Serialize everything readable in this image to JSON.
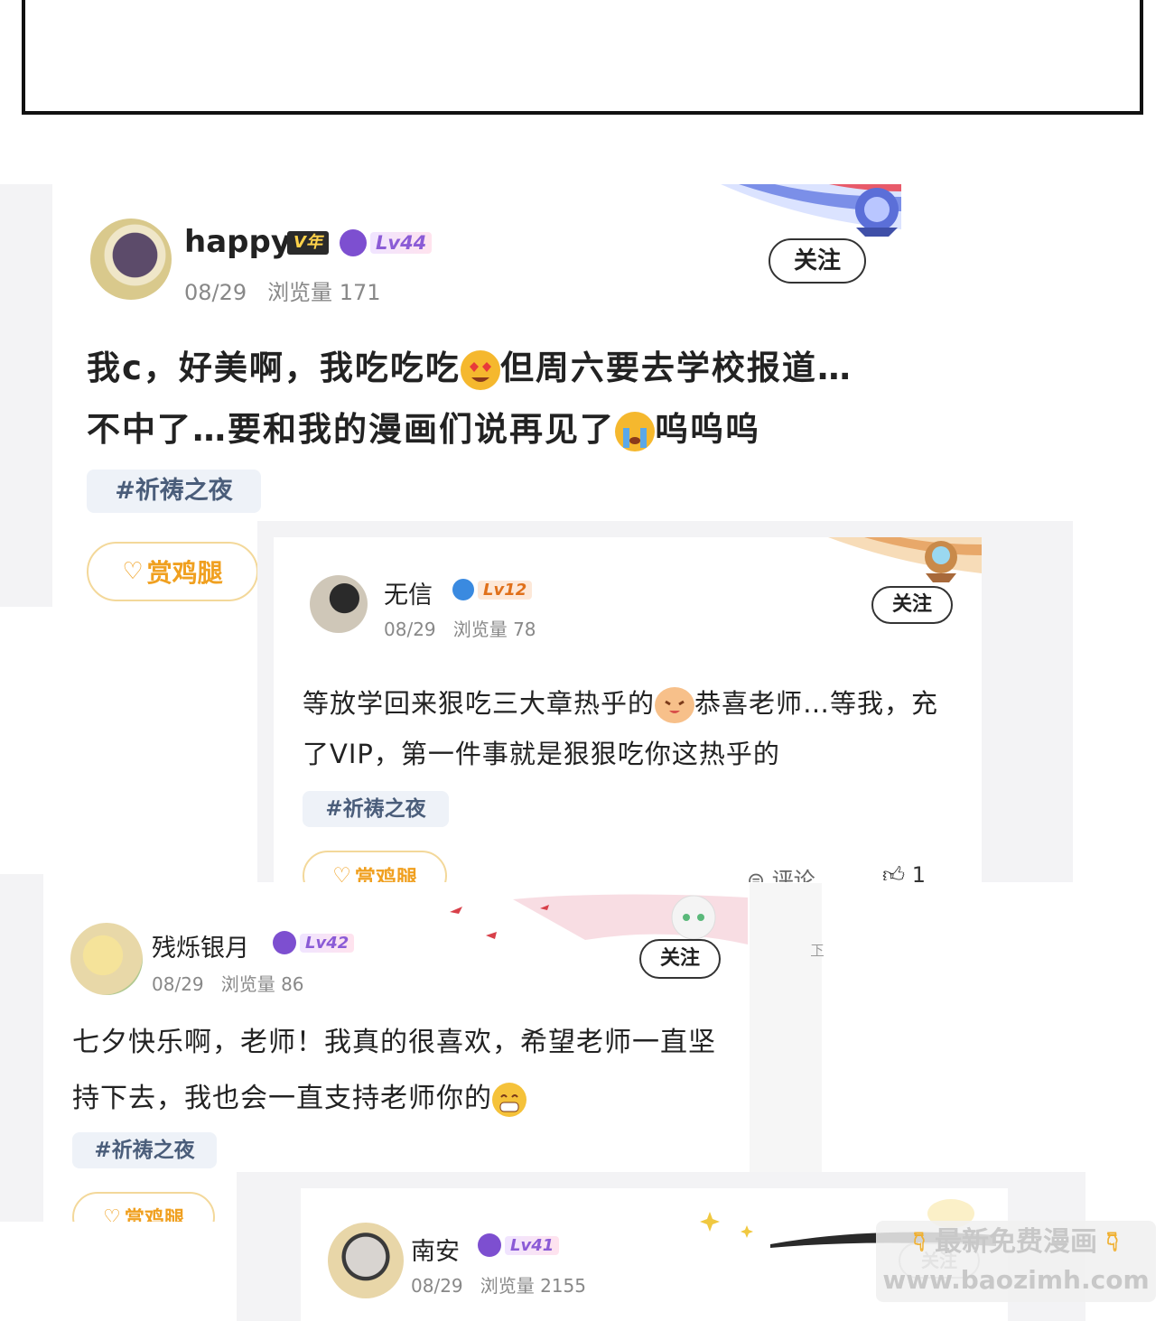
{
  "posts": [
    {
      "username": "happy",
      "vip_badge": "V年",
      "level": "Lv44",
      "date": "08/29",
      "views_label": "浏览量",
      "views": "171",
      "follow_label": "关注",
      "text_before": "我c，好美啊，我吃吃吃",
      "text_mid": "但周六要去学校报道…不中了…要和我的漫画们说再见了",
      "text_after": "呜呜呜",
      "tag": "#祈祷之夜",
      "reward_label": "赏鸡腿"
    },
    {
      "username": "无信",
      "level": "Lv12",
      "date": "08/29",
      "views_label": "浏览量",
      "views": "78",
      "follow_label": "关注",
      "text_before": "等放学回来狠吃三大章热乎的",
      "text_after": "恭喜老师…等我，充了VIP，第一件事就是狠狠吃你这热乎的",
      "tag": "#祈祷之夜",
      "reward_label": "赏鸡腿",
      "comment_label": "评论",
      "like_count": "1"
    },
    {
      "username": "残烁银月",
      "level": "Lv42",
      "date": "08/29",
      "views_label": "浏览量",
      "views": "86",
      "follow_label": "关注",
      "text_before": "七夕快乐啊，老师！我真的很喜欢，希望老师一直坚持下去，我也会一直支持老师你的",
      "tag": "#祈祷之夜",
      "reward_label": "赏鸡腿",
      "side_label": "下"
    },
    {
      "username": "南安",
      "level": "Lv41",
      "date": "08/29",
      "views_label": "浏览量",
      "views": "2155",
      "follow_label": "关注"
    }
  ],
  "watermark": {
    "line1": "最新免费漫画",
    "line2": "www.baozimh.com"
  },
  "colors": {
    "reward": "#f0a020",
    "level": "#8b5bd6",
    "tag_bg": "#eef2f8",
    "tag_text": "#4a5d7a"
  },
  "icons": [
    "heart-eyes-emoji-icon",
    "crying-emoji-icon",
    "cat-emoji-icon",
    "grin-emoji-icon",
    "gift-icon",
    "comment-icon",
    "thumb-up-icon",
    "level-icon",
    "badge-icon"
  ]
}
